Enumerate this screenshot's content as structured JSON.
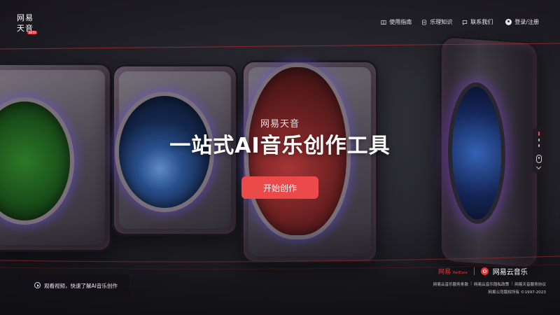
{
  "header": {
    "logo": {
      "line1": "网易",
      "line2": "天音",
      "badge": "BETA"
    },
    "nav": [
      {
        "label": "使用指南",
        "icon": "book-icon"
      },
      {
        "label": "乐理知识",
        "icon": "document-icon"
      },
      {
        "label": "联系我们",
        "icon": "chat-icon"
      },
      {
        "label": "登录/注册",
        "icon": "user-icon"
      }
    ]
  },
  "hero": {
    "subtitle": "网易天音",
    "headline": "一站式AI音乐创作工具",
    "cta_label": "开始创作"
  },
  "video_button": {
    "label": "观看视频，快速了解AI音乐创作"
  },
  "footer": {
    "brand_netease": "网易",
    "brand_netease_en": "NetEase",
    "brand_cloudmusic": "网易云音乐",
    "links": [
      "网易云音乐服务条款",
      "网易云音乐隐私政策",
      "网易天音服务协议"
    ],
    "copyright": "网易公司版权所有 ©1997-2023"
  },
  "colors": {
    "accent": "#ec4a4a",
    "background": "#1b1a20",
    "brand_red": "#e8353a"
  }
}
